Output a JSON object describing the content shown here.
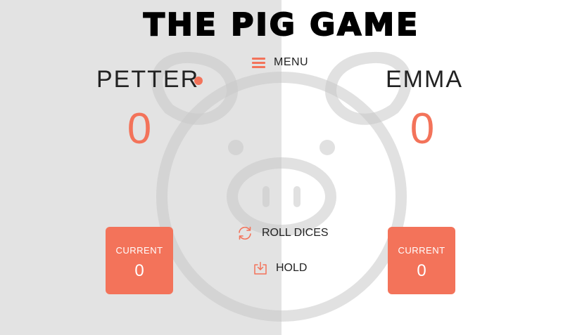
{
  "title": "THE PIG GAME",
  "menu": {
    "label": "MENU",
    "icon": "hamburger-menu-icon"
  },
  "players": [
    {
      "name": "PETTER",
      "score": "0",
      "current_label": "CURRENT",
      "current": "0",
      "active": true
    },
    {
      "name": "EMMA",
      "score": "0",
      "current_label": "CURRENT",
      "current": "0",
      "active": false
    }
  ],
  "actions": {
    "roll_label": "ROLL DICES",
    "roll_icon": "refresh-icon",
    "hold_label": "HOLD",
    "hold_icon": "download-icon"
  },
  "colors": {
    "accent": "#f3735a",
    "left_panel": "#e3e3e3",
    "right_panel": "#ffffff",
    "text": "#222222"
  }
}
